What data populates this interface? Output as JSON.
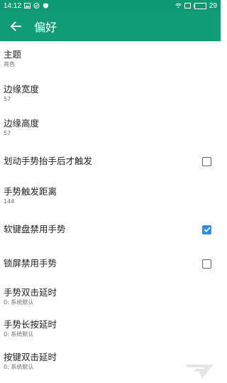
{
  "status_bar": {
    "time": "14:12",
    "battery": "29"
  },
  "app_bar": {
    "title": "偏好"
  },
  "settings": [
    {
      "title": "主题",
      "subtitle": "亮色"
    },
    {
      "title": "边缘宽度",
      "subtitle": "57"
    },
    {
      "title": "边缘高度",
      "subtitle": "57"
    },
    {
      "title": "划动手势抬手后才触发",
      "checked": false
    },
    {
      "title": "手势触发距离",
      "subtitle": "144"
    },
    {
      "title": "软键盘禁用手势",
      "checked": true
    },
    {
      "title": "锁屏禁用手势",
      "checked": false
    },
    {
      "title": "手势双击延时",
      "subtitle": "0: 系统默认"
    },
    {
      "title": "手势长按延时",
      "subtitle": "0: 系统默认"
    },
    {
      "title": "按键双击延时",
      "subtitle": "0: 系统默认"
    }
  ],
  "colors": {
    "primary": "#109c74",
    "status_bar": "#0d9a72",
    "accent": "#2f8fd8"
  }
}
